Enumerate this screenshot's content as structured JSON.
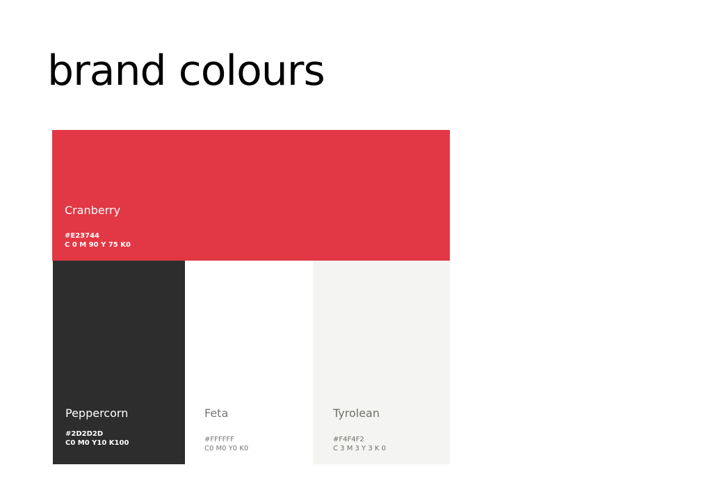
{
  "title": "brand colours",
  "swatches": {
    "cranberry": {
      "name": "Cranberry",
      "hex_label": "#E23744",
      "cmyk": "C 0 M 90 Y 75 K0",
      "color": "#E23744"
    },
    "peppercorn": {
      "name": "Peppercorn",
      "hex_label": "#2D2D2D",
      "cmyk": "C0 M0 Y10 K100",
      "color": "#2D2D2D"
    },
    "feta": {
      "name": "Feta",
      "hex_label": "#FFFFFF",
      "cmyk": "C0 M0 Y0 K0",
      "color": "#FFFFFF"
    },
    "tyrolean": {
      "name": "Tyrolean",
      "hex_label": "#F4F4F2",
      "cmyk": "C 3 M 3 Y 3 K 0",
      "color": "#F4F4F2"
    }
  }
}
